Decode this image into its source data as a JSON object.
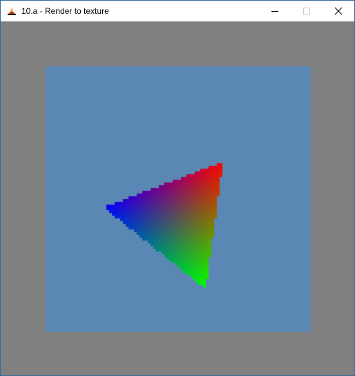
{
  "window": {
    "title": "10.a - Render to texture",
    "app_icon": "opengl-app-icon",
    "controls": {
      "minimize_icon": "minimize-icon",
      "maximize_icon": "maximize-icon",
      "close_icon": "close-icon"
    }
  },
  "viewport": {
    "clear_color": "#808080",
    "quad_color": "#5a87b3",
    "triangle": {
      "vertex_colors": [
        "#ff0000",
        "#00ff00",
        "#0000ff"
      ]
    }
  }
}
